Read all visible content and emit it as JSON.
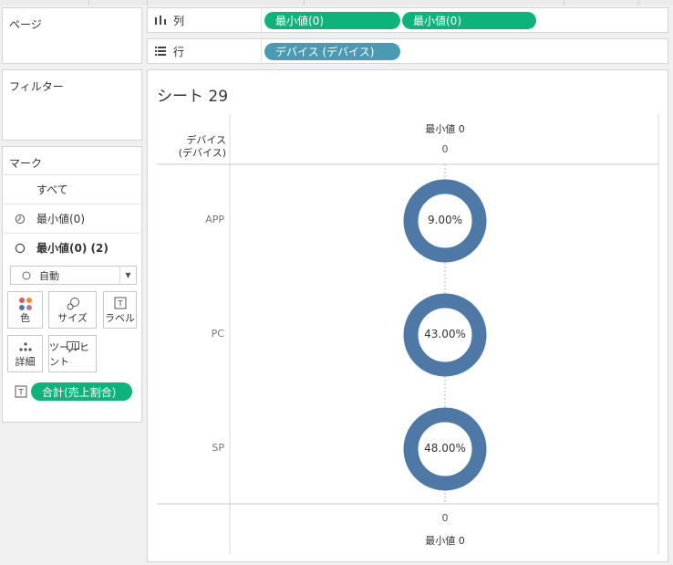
{
  "pages_panel": {
    "title": "ページ"
  },
  "filters_panel": {
    "title": "フィルター"
  },
  "shelves": {
    "columns": {
      "label": "列",
      "pills": [
        "最小値(0)",
        "最小値(0)"
      ]
    },
    "rows": {
      "label": "行",
      "pills": [
        "デバイス (デバイス)"
      ]
    }
  },
  "marks": {
    "title": "マーク",
    "layers": [
      {
        "label": "すべて"
      },
      {
        "label": "最小値(0)"
      },
      {
        "label": "最小値(0) (2)"
      }
    ],
    "mark_type": "自動",
    "buttons": {
      "color": "色",
      "size": "サイズ",
      "label": "ラベル",
      "detail": "詳細",
      "tooltip": "ツールヒント"
    },
    "label_pill": "合計(売上割合)"
  },
  "view": {
    "title": "シート 29",
    "row_header": [
      "デバイス",
      "(デバイス)"
    ],
    "top_axis_title": "最小値 0",
    "top_axis_tick": "0",
    "bottom_axis_tick": "0",
    "bottom_axis_title": "最小値 0",
    "donut_color": "#4e79a7"
  },
  "chart_data": {
    "type": "pie",
    "categories": [
      "APP",
      "PC",
      "SP"
    ],
    "values": [
      9.0,
      43.0,
      48.0
    ],
    "value_labels": [
      "9.00%",
      "43.00%",
      "48.00%"
    ]
  }
}
